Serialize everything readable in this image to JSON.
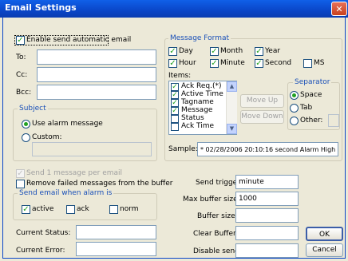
{
  "window": {
    "title": "Email Settings",
    "close_glyph": "✕"
  },
  "general": {
    "enable_label": "Enable send automatic email",
    "to_label": "To:",
    "cc_label": "Cc:",
    "bcc_label": "Bcc:",
    "to_value": "",
    "cc_value": "",
    "bcc_value": ""
  },
  "subject": {
    "group_label": "Subject",
    "use_alarm_label": "Use alarm message",
    "custom_label": "Custom:",
    "custom_value": "",
    "selected": "Use alarm message"
  },
  "message_format": {
    "group_label": "Message Format",
    "day": "Day",
    "month": "Month",
    "year": "Year",
    "hour": "Hour",
    "minute": "Minute",
    "second": "Second",
    "ms": "MS",
    "items_label": "Items:",
    "items": [
      {
        "label": "Ack Req.(*)",
        "checked": true
      },
      {
        "label": "Active Time",
        "checked": true
      },
      {
        "label": "Tagname",
        "checked": true
      },
      {
        "label": "Message",
        "checked": true
      },
      {
        "label": "Status",
        "checked": false
      },
      {
        "label": "Ack Time",
        "checked": false
      }
    ],
    "move_up": "Move Up",
    "move_down": "Move Down",
    "separator_label": "Separator",
    "space": "Space",
    "tab": "Tab",
    "other": "Other:",
    "separator_selected": "Space",
    "sample_label": "Sample:",
    "sample_value": "* 02/28/2006 20:10:16 second Alarm High"
  },
  "options": {
    "send_one_label": "Send 1 message per email",
    "remove_failed_label": "Remove failed messages from the buffer",
    "when_group_label": "Send email when alarm is",
    "active": "active",
    "ack": "ack",
    "norm": "norm"
  },
  "right_fields": {
    "send_trigger_label": "Send trigger:",
    "send_trigger_value": "minute",
    "max_buffer_label": "Max buffer size:",
    "max_buffer_value": "1000",
    "buffer_size_label": "Buffer size:",
    "buffer_size_value": "",
    "clear_buffer_label": "Clear Buffer:",
    "clear_buffer_value": "",
    "disable_send_label": "Disable send:",
    "disable_send_value": ""
  },
  "status": {
    "current_status_label": "Current Status:",
    "current_status_value": "",
    "current_error_label": "Current Error:",
    "current_error_value": ""
  },
  "buttons": {
    "ok": "OK",
    "cancel": "Cancel"
  },
  "icons": {
    "check": "✓",
    "scroll_up": "▲",
    "scroll_down": "▼"
  },
  "colors": {
    "titlebar": "#0a46c8",
    "group_label": "#1a50b8",
    "check": "#21a121",
    "face": "#ece9d8"
  }
}
